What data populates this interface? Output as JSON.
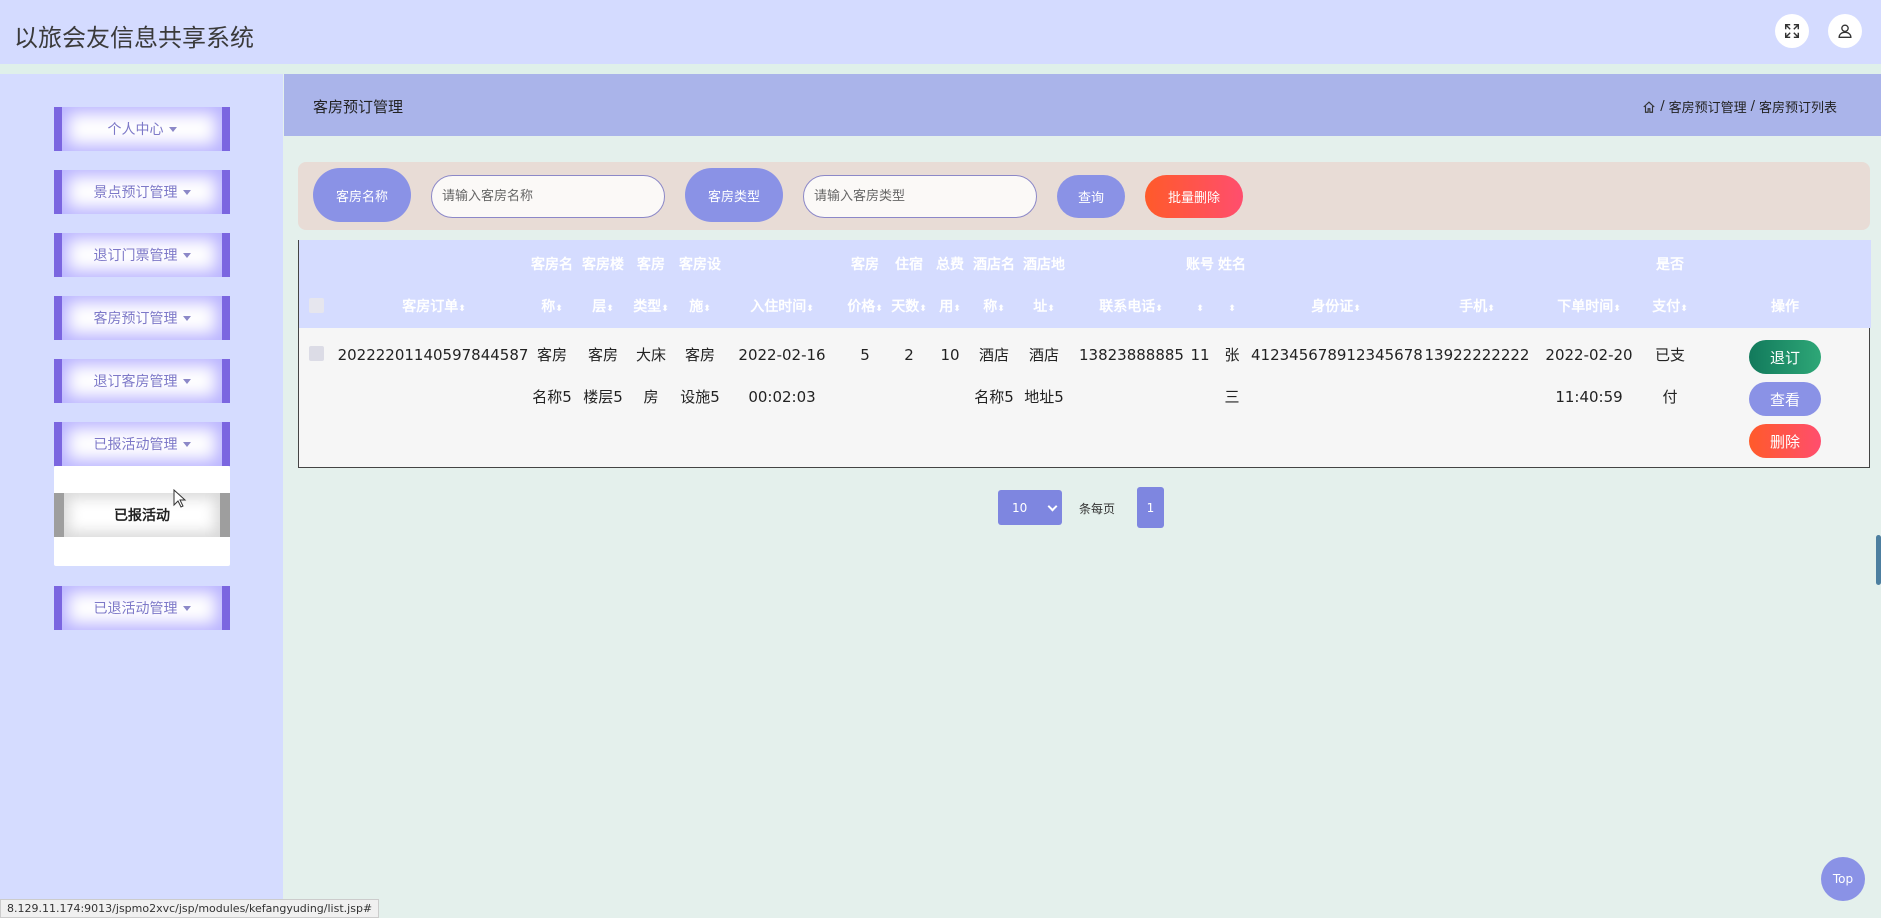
{
  "app": {
    "title": "以旅会友信息共享系统"
  },
  "header": {
    "fullscreen_icon": "expand-icon",
    "user_icon": "user-icon"
  },
  "sidebar": {
    "items": [
      {
        "label": "个人中心"
      },
      {
        "label": "景点预订管理"
      },
      {
        "label": "退订门票管理"
      },
      {
        "label": "客房预订管理"
      },
      {
        "label": "退订客房管理"
      },
      {
        "label": "已报活动管理"
      },
      {
        "label": "已退活动管理"
      }
    ],
    "submenu": {
      "label": "已报活动"
    }
  },
  "page": {
    "title": "客房预订管理",
    "breadcrumb": {
      "home_icon": "home-icon",
      "level1": "客房预订管理",
      "sep": "/",
      "level2": "客房预订列表"
    }
  },
  "search": {
    "name_label": "客房名称",
    "name_placeholder": "请输入客房名称",
    "type_label": "客房类型",
    "type_placeholder": "请输入客房类型",
    "query_button": "查询",
    "batch_delete_button": "批量删除"
  },
  "table": {
    "headers": {
      "order_no": "客房订单",
      "room_name_1": "客房名",
      "room_name_2": "称",
      "floor_1": "客房楼",
      "floor_2": "层",
      "type_1": "客房",
      "type_2": "类型",
      "facility_1": "客房设",
      "facility_2": "施",
      "checkin_time": "入住时间",
      "price_1": "客房",
      "price_2": "价格",
      "days_1": "住宿",
      "days_2": "天数",
      "total_1": "总费",
      "total_2": "用",
      "hotel_name_1": "酒店名",
      "hotel_name_2": "称",
      "hotel_addr_1": "酒店地",
      "hotel_addr_2": "址",
      "phone": "联系电话",
      "account": "账号",
      "name": "姓名",
      "id_card": "身份证",
      "mobile": "手机",
      "order_time": "下单时间",
      "paid_1": "是否",
      "paid_2": "支付",
      "actions": "操作"
    },
    "sort_glyph": "⬍",
    "rows": [
      {
        "order_no": "20222201140597844587",
        "room_name_1": "客房",
        "room_name_2": "名称5",
        "floor_1": "客房",
        "floor_2": "楼层5",
        "type_1": "大床",
        "type_2": "房",
        "facility_1": "客房",
        "facility_2": "设施5",
        "checkin_1": "2022-02-16",
        "checkin_2": "00:02:03",
        "price": "5",
        "days": "2",
        "total": "10",
        "hotel_name_1": "酒店",
        "hotel_name_2": "名称5",
        "hotel_addr_1": "酒店",
        "hotel_addr_2": "地址5",
        "phone": "13823888885",
        "account": "11",
        "name_1": "张",
        "name_2": "三",
        "id_card": "412345678912345678",
        "mobile": "13922222222",
        "order_time_1": "2022-02-20",
        "order_time_2": "11:40:59",
        "paid_1": "已支",
        "paid_2": "付",
        "actions": {
          "refund": "退订",
          "view": "查看",
          "delete": "删除"
        }
      }
    ]
  },
  "pagination": {
    "page_size": "10",
    "per_page_label": "条每页",
    "current_page": "1"
  },
  "top_button": "Top",
  "status_url": "8.129.11.174:9013/jspmo2xvc/jsp/modules/kefangyuding/list.jsp#"
}
